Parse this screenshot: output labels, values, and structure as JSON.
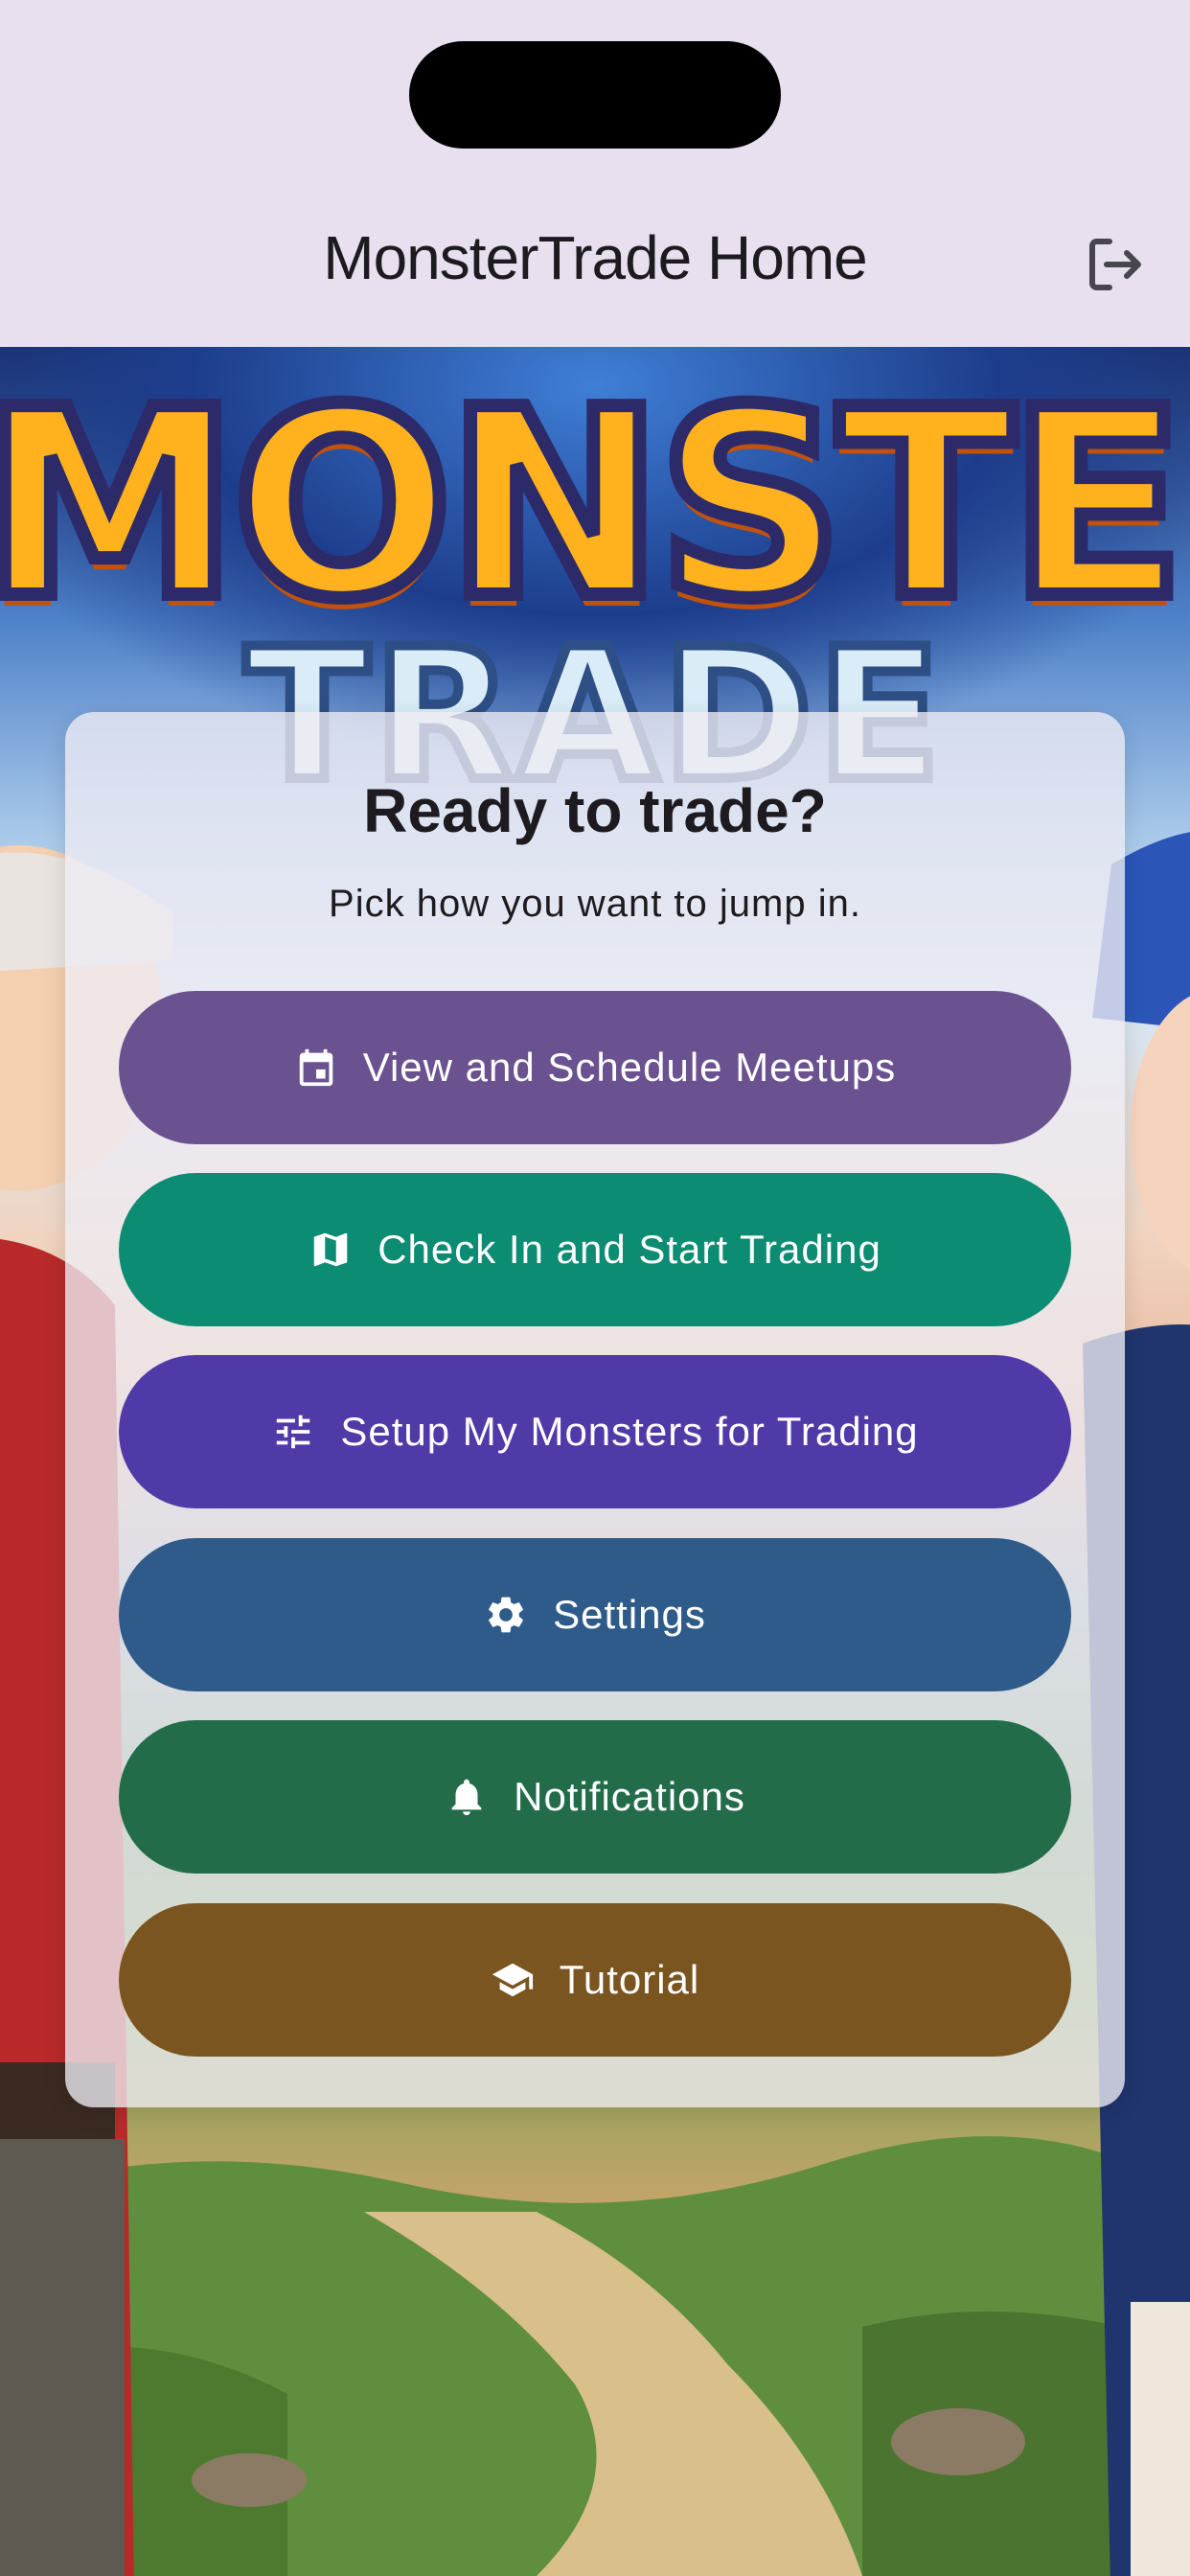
{
  "app_bar": {
    "title": "MonsterTrade Home",
    "logout_icon": "logout-icon"
  },
  "background": {
    "logo_line1": "MONSTER",
    "logo_line2": "TRADE"
  },
  "card": {
    "title": "Ready to trade?",
    "subtitle": "Pick how you want to jump in.",
    "buttons": [
      {
        "label": "View and Schedule Meetups",
        "icon": "calendar-icon",
        "color": "#6a5290"
      },
      {
        "label": "Check In and Start Trading",
        "icon": "map-icon",
        "color": "#0c8c72"
      },
      {
        "label": "Setup My Monsters for Trading",
        "icon": "tune-sliders-icon",
        "color": "#4f3aa8"
      },
      {
        "label": "Settings",
        "icon": "gear-icon",
        "color": "#2e5b8a"
      },
      {
        "label": "Notifications",
        "icon": "bell-icon",
        "color": "#226c4a"
      },
      {
        "label": "Tutorial",
        "icon": "graduation-cap-icon",
        "color": "#7a5520"
      }
    ]
  }
}
